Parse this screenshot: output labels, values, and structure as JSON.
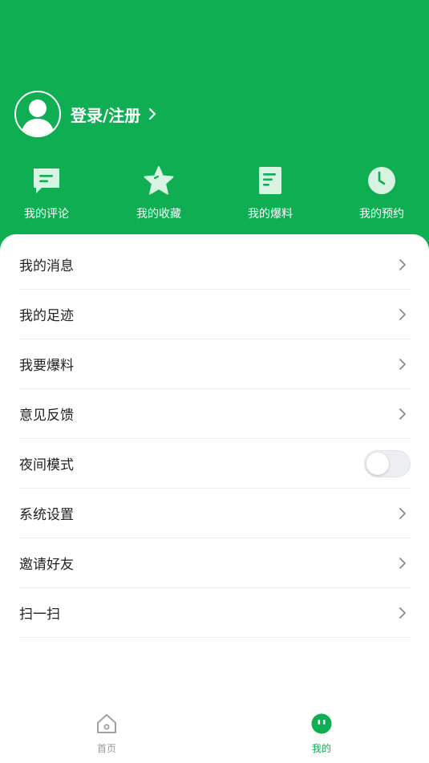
{
  "colors": {
    "brand_green": "#0fae53",
    "tab_inactive": "#9a9a9a",
    "text_primary": "#222222"
  },
  "profile": {
    "login_label": "登录/注册",
    "avatar_icon": "user-silhouette-icon"
  },
  "quick_actions": [
    {
      "label": "我的评论",
      "icon": "comment-icon"
    },
    {
      "label": "我的收藏",
      "icon": "star-icon"
    },
    {
      "label": "我的爆料",
      "icon": "document-icon"
    },
    {
      "label": "我的预约",
      "icon": "clock-icon"
    }
  ],
  "menu": [
    {
      "label": "我的消息",
      "control": "chevron"
    },
    {
      "label": "我的足迹",
      "control": "chevron"
    },
    {
      "label": "我要爆料",
      "control": "chevron"
    },
    {
      "label": "意见反馈",
      "control": "chevron"
    },
    {
      "label": "夜间模式",
      "control": "toggle",
      "toggle_on": false
    },
    {
      "label": "系统设置",
      "control": "chevron"
    },
    {
      "label": "邀请好友",
      "control": "chevron"
    },
    {
      "label": "扫一扫",
      "control": "chevron"
    }
  ],
  "tabbar": {
    "tabs": [
      {
        "label": "首页",
        "icon": "home-icon",
        "active": false
      },
      {
        "label": "我的",
        "icon": "profile-face-icon",
        "active": true
      }
    ]
  }
}
